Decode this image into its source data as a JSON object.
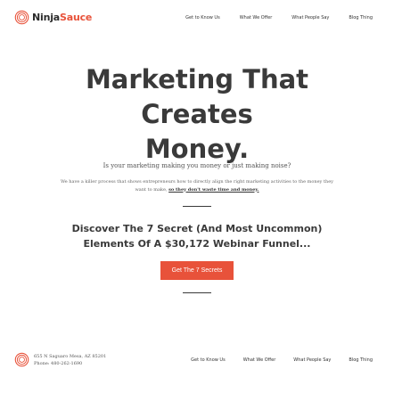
{
  "brand": {
    "name_part1": "Ninja",
    "name_part2": "Sauce",
    "accent_color": "#e8523a"
  },
  "nav": {
    "items": [
      "Get to Know Us",
      "What We Offer",
      "What People Say",
      "Blog Thing"
    ]
  },
  "hero": {
    "title_line1": "Marketing That Creates",
    "title_line2": "Money.",
    "question": "Is your marketing making you money or just making noise?",
    "description_text": "We have a killer process that shows entrepreneurs how to directly align the right marketing activities to the money they want to make,",
    "description_link": "so they don't waste time and money."
  },
  "promo": {
    "line1": "Discover The 7 Secret (And Most Uncommon)",
    "line2": "Elements Of A $30,172 Webinar Funnel...",
    "button_label": "Get The 7 Secrets"
  },
  "footer": {
    "address": "655 N Saguaro Mesa, AZ 85201",
    "phone": "Phone: 480-262-1690",
    "nav": [
      "Get to Know Us",
      "What We Offer",
      "What People Say",
      "Blog Thing"
    ]
  }
}
